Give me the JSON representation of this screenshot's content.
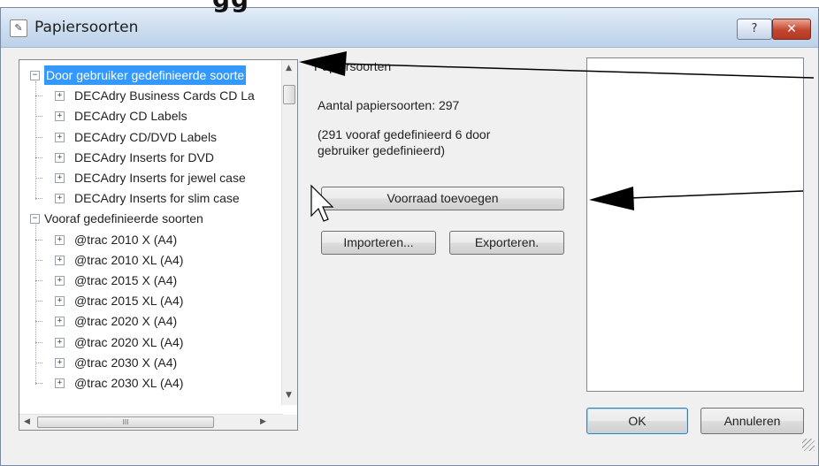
{
  "headword": "gg",
  "window": {
    "title": "Papiersoorten",
    "help_label": "?",
    "close_label": "✕"
  },
  "tree": {
    "groups": [
      {
        "label": "Door gebruiker gedefinieerde soorte",
        "selected": true,
        "items": [
          "DECAdry Business Cards CD La",
          "DECAdry CD Labels",
          "DECAdry CD/DVD Labels",
          "DECAdry Inserts for DVD",
          "DECAdry Inserts for jewel case",
          "DECAdry Inserts for slim case"
        ]
      },
      {
        "label": "Vooraf gedefinieerde soorten",
        "selected": false,
        "items": [
          "@trac 2010 X (A4)",
          "@trac 2010 XL (A4)",
          "@trac 2015 X (A4)",
          "@trac 2015 XL (A4)",
          "@trac 2020 X (A4)",
          "@trac 2020 XL (A4)",
          "@trac 2030 X (A4)",
          "@trac 2030 XL (A4)"
        ]
      }
    ],
    "hscroll_thumb_label": "III"
  },
  "info": {
    "header": "Papiersoorten",
    "count": "Aantal papiersoorten: 297",
    "detail_line1": "(291 vooraf gedefinieerd  6 door",
    "detail_line2": "gebruiker gedefinieerd)"
  },
  "buttons": {
    "add_stock": "Voorraad toevoegen",
    "import": "Importeren...",
    "export": "Exporteren.",
    "ok": "OK",
    "cancel": "Annuleren"
  },
  "icons": {
    "expand": "plus-box-icon",
    "collapse": "minus-box-icon",
    "cursor": "mouse-pointer-icon"
  },
  "colors": {
    "selection": "#3399ff",
    "titlebar": "#c9dbee",
    "close": "#c3462e"
  }
}
